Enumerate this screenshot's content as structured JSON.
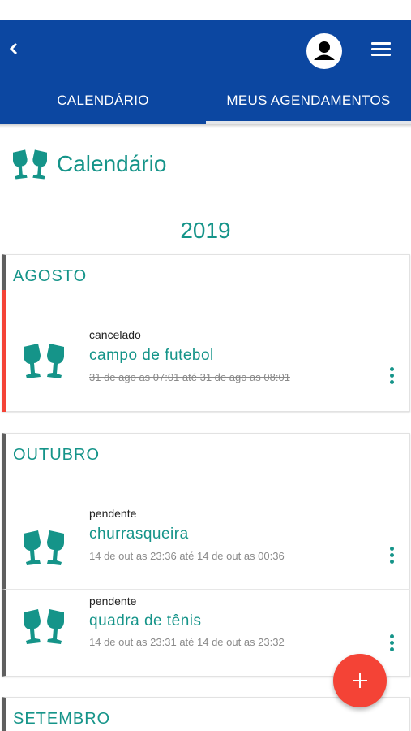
{
  "header": {
    "tabs": [
      "CALENDÁRIO",
      "MEUS AGENDAMENTOS"
    ],
    "active_tab": "MEUS AGENDAMENTOS",
    "color": "#0c47a1"
  },
  "page": {
    "title": "Calendário",
    "title_icon": "wine-glasses-icon",
    "accent": "#159489"
  },
  "year": "2019",
  "months": [
    {
      "name": "AGOSTO",
      "events": [
        {
          "status": "cancelado",
          "name": "campo de futebol",
          "time": "31 de ago as 07:01 até 31 de ago as 08:01",
          "struck": true,
          "status_color": "#f44336"
        }
      ]
    },
    {
      "name": "OUTUBRO",
      "events": [
        {
          "status": "pendente",
          "name": "churrasqueira",
          "time": "14 de out as 23:36 até 14 de out as 00:36"
        },
        {
          "status": "pendente",
          "name": "quadra de tênis",
          "time": "14 de out as 23:31 até 14 de out as 23:32"
        }
      ]
    },
    {
      "name": "SETEMBRO",
      "events": []
    }
  ],
  "fab": {
    "icon": "plus-icon",
    "color": "#f44336"
  }
}
